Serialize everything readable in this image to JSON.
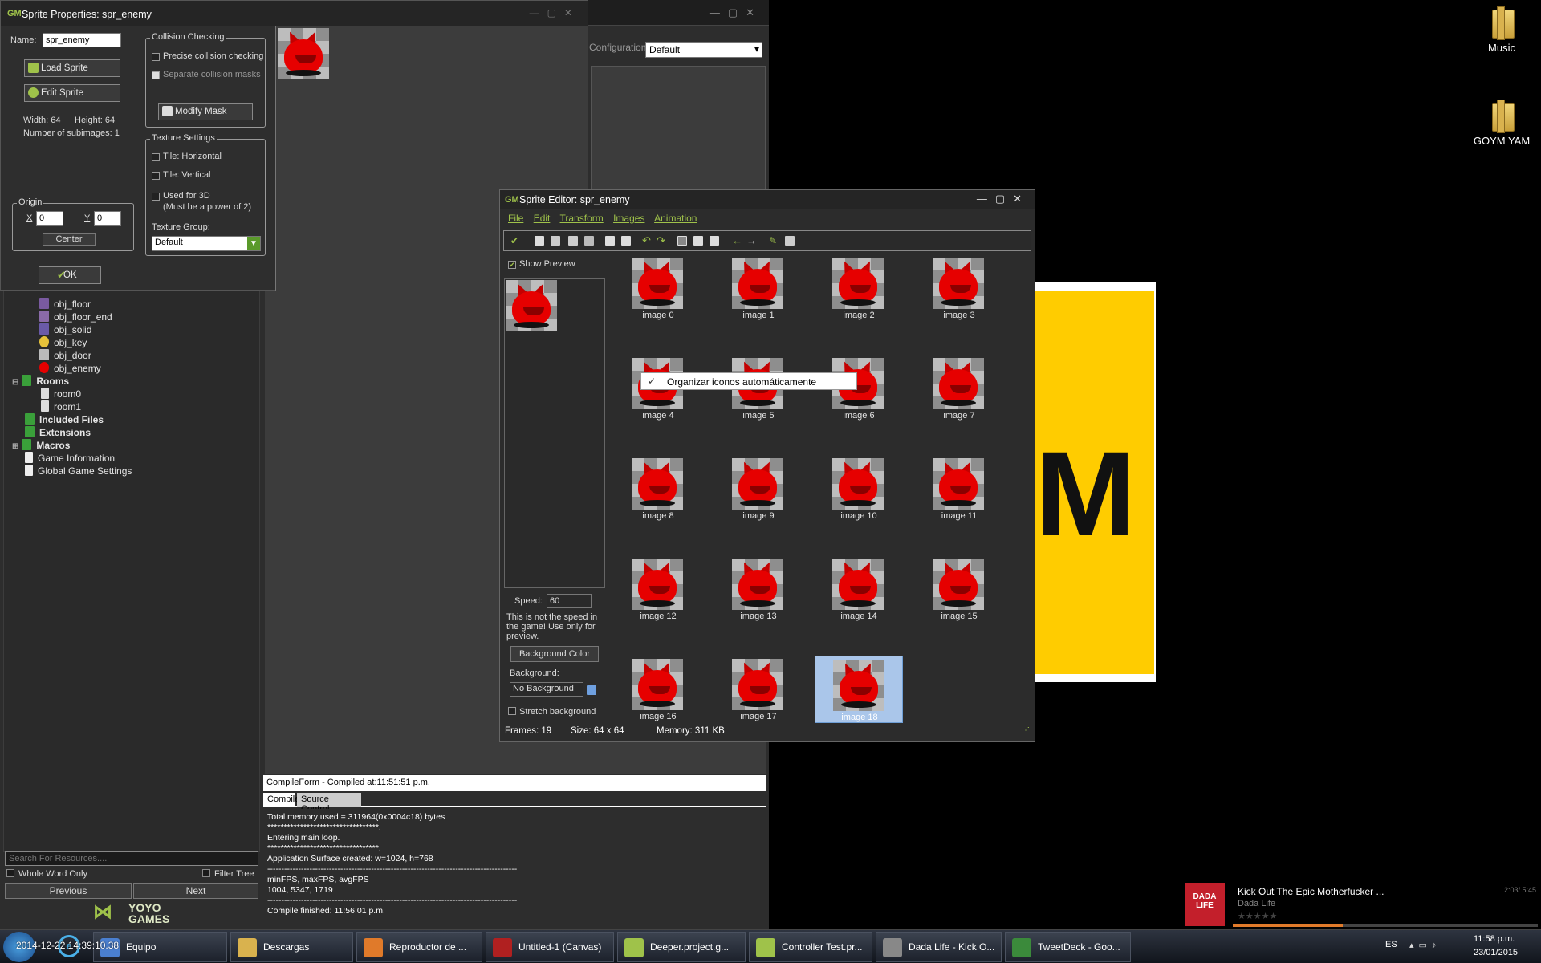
{
  "desktop": {
    "icons": [
      {
        "label": "Music"
      },
      {
        "label": "GOYM YAM"
      }
    ],
    "poster_letter": "M"
  },
  "ide": {
    "configuration_label": "Configuration:",
    "configuration_value": "Default",
    "tree": [
      {
        "label": "obj_floor",
        "bold": false
      },
      {
        "label": "obj_floor_end",
        "bold": false
      },
      {
        "label": "obj_solid",
        "bold": false
      },
      {
        "label": "obj_key",
        "bold": false
      },
      {
        "label": "obj_door",
        "bold": false
      },
      {
        "label": "obj_enemy",
        "bold": false
      },
      {
        "label": "Rooms",
        "bold": true
      },
      {
        "label": "room0",
        "bold": false
      },
      {
        "label": "room1",
        "bold": false
      },
      {
        "label": "Included Files",
        "bold": true
      },
      {
        "label": "Extensions",
        "bold": true
      },
      {
        "label": "Macros",
        "bold": true
      },
      {
        "label": "Game Information",
        "bold": false
      },
      {
        "label": "Global Game Settings",
        "bold": false
      }
    ],
    "search_placeholder": "Search For Resources....",
    "whole_word_label": "Whole Word Only",
    "filter_tree_label": "Filter Tree",
    "previous_label": "Previous",
    "next_label": "Next",
    "yoyo_logo": [
      "YOYO",
      "GAMES"
    ],
    "compile_header": "CompileForm - Compiled at:11:51:51 p.m.",
    "compile_tabs": [
      "Compile",
      "Source Control"
    ],
    "compile_log": "Total memory used = 311964(0x0004c18) bytes\n**********************************.\nEntering main loop.\n**********************************.\nApplication Surface created: w=1024, h=768\n-----------------------------------------------------------------------------------------\nminFPS, maxFPS, avgFPS\n1004, 5347, 1719\n-----------------------------------------------------------------------------------------\nCompile finished: 11:56:01 p.m."
  },
  "sprite_properties": {
    "title": "Sprite Properties: spr_enemy",
    "name_label": "Name:",
    "name_value": "spr_enemy",
    "load_sprite": "Load Sprite",
    "edit_sprite": "Edit Sprite",
    "width_text": "Width: 64",
    "height_text": "Height: 64",
    "subimages_text": "Number of subimages: 1",
    "origin_label": "Origin",
    "x_label": "X",
    "x_value": "0",
    "y_label": "Y",
    "y_value": "0",
    "center_label": "Center",
    "ok_label": "OK",
    "collision_label": "Collision Checking",
    "precise_label": "Precise collision checking",
    "separate_label": "Separate collision masks",
    "modify_mask_label": "Modify Mask",
    "texture_label": "Texture Settings",
    "tile_h_label": "Tile: Horizontal",
    "tile_v_label": "Tile: Vertical",
    "used3d_label": "Used for 3D",
    "used3d_note": "(Must be a power of 2)",
    "texture_group_label": "Texture Group:",
    "texture_group_value": "Default"
  },
  "sprite_editor": {
    "title": "Sprite Editor: spr_enemy",
    "menu": [
      "File",
      "Edit",
      "Transform",
      "Images",
      "Animation"
    ],
    "show_preview": "Show Preview",
    "speed_label": "Speed:",
    "speed_value": "60",
    "speed_note": "This is not the speed in the game! Use only for preview.",
    "background_color_btn": "Background Color",
    "background_label": "Background:",
    "background_value": "No Background",
    "stretch_label": "Stretch background",
    "images": [
      "image 0",
      "image 1",
      "image 2",
      "image 3",
      "image 4",
      "image 5",
      "image 6",
      "image 7",
      "image 8",
      "image 9",
      "image 10",
      "image 11",
      "image 12",
      "image 13",
      "image 14",
      "image 15",
      "image 16",
      "image 17",
      "image 18"
    ],
    "selected_index": 18,
    "context_menu_item": "Organizar iconos automáticamente",
    "status_frames": "Frames: 19",
    "status_size": "Size: 64 x 64",
    "status_memory": "Memory: 311 KB"
  },
  "media_player": {
    "art_text": [
      "DADA",
      "LIFE"
    ],
    "track": "Kick Out The Epic Motherfucker ...",
    "artist": "Dada Life",
    "time": "2:03/ 5:45",
    "progress": 0.36
  },
  "taskbar": {
    "items": [
      {
        "label": "Equipo",
        "color": "#4a7fd0"
      },
      {
        "label": "Descargas",
        "color": "#d9b24e"
      },
      {
        "label": "Reproductor de ...",
        "color": "#e07a2a"
      },
      {
        "label": "Untitled-1 (Canvas)",
        "color": "#b02020"
      },
      {
        "label": "Deeper.project.g...",
        "color": "#9fc24a"
      },
      {
        "label": "Controller Test.pr...",
        "color": "#9fc24a"
      },
      {
        "label": "Dada Life - Kick O...",
        "color": "#888888"
      },
      {
        "label": "TweetDeck - Goo...",
        "color": "#3b8a3b"
      }
    ],
    "overlay_text": "2014-12-22 14:39:10.38",
    "lang": "ES",
    "time": "11:58 p.m.",
    "date": "23/01/2015"
  }
}
